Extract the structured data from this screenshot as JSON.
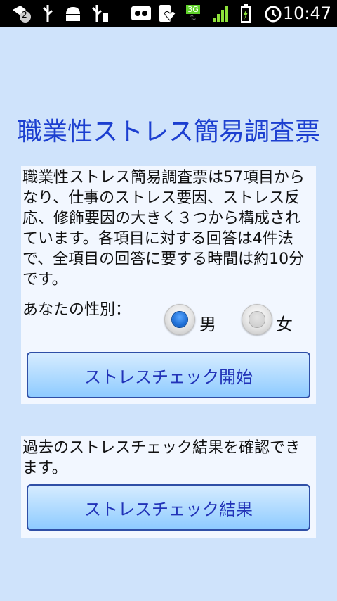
{
  "status_bar": {
    "notification_count": "2",
    "network_type": "3G",
    "time": "10:47"
  },
  "title": "職業性ストレス簡易調査票",
  "intro": {
    "description": "職業性ストレス簡易調査票は57項目からなり、仕事のストレス要因、ストレス反応、修飾要因の大きく３つから構成されています。各項目に対する回答は4件法で、全項目の回答に要する時間は約10分です。",
    "gender_label": "あなたの性別：",
    "gender_options": [
      {
        "label": "男",
        "selected": true
      },
      {
        "label": "女",
        "selected": false
      }
    ],
    "start_button": "ストレスチェック開始"
  },
  "history": {
    "description": "過去のストレスチェック結果を確認できます。",
    "result_button": "ストレスチェック結果"
  },
  "colors": {
    "background": "#cfe3fb",
    "title": "#1c3fd0",
    "button_text": "#2233b8",
    "radio_selected": "#1f6fd6"
  }
}
